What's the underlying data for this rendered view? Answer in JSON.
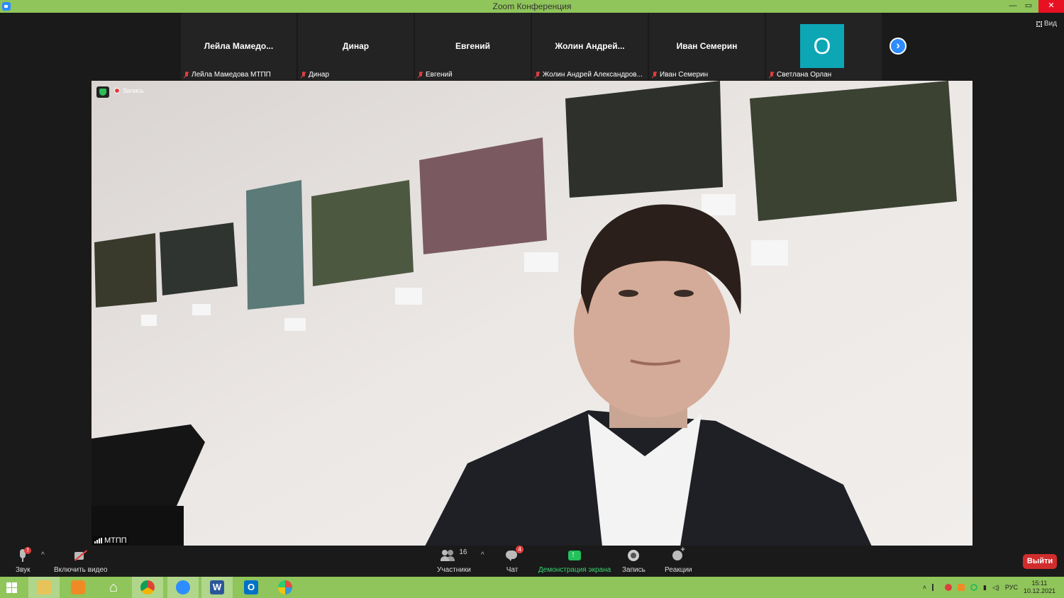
{
  "window": {
    "title": "Zoom Конференция",
    "min": "—",
    "max": "▭",
    "close": "✕"
  },
  "view_button": {
    "label": "Вид"
  },
  "thumbnails": [
    {
      "name": "Лейла  Мамедо...",
      "label": "Лейла Мамедова МТПП",
      "muted": true
    },
    {
      "name": "Динар",
      "label": "Динар",
      "muted": true
    },
    {
      "name": "Евгений",
      "label": "Евгений",
      "muted": true
    },
    {
      "name": "Жолин  Андрей...",
      "label": "Жолин Андрей Александров...",
      "muted": true
    },
    {
      "name": "Иван Семерин",
      "label": "Иван Семерин",
      "muted": true
    },
    {
      "name": "",
      "avatar_letter": "О",
      "avatar_color": "#0da6b5",
      "label": "Светлана Орлан",
      "muted": true
    }
  ],
  "video": {
    "recording_label": "Запись",
    "speaker_label": "МТПП"
  },
  "toolbar": {
    "audio": {
      "label": "Звук",
      "badge": "!"
    },
    "video": {
      "label": "Включить видео"
    },
    "participants": {
      "label": "Участники",
      "count": "16"
    },
    "chat": {
      "label": "Чат",
      "badge": "4"
    },
    "share": {
      "label": "Демонстрация экрана"
    },
    "record": {
      "label": "Запись"
    },
    "reactions": {
      "label": "Реакции"
    },
    "leave": {
      "label": "Выйти"
    }
  },
  "taskbar": {
    "language": "РУС",
    "time": "15:11",
    "date": "10.12.2021",
    "apps": [
      "windows-start",
      "file-explorer",
      "media-player",
      "home",
      "chrome",
      "zoom",
      "word",
      "outlook",
      "paint"
    ]
  },
  "colors": {
    "accent_green": "#8fc55a",
    "zoom_blue": "#2d8cff",
    "leave_red": "#d12d2d",
    "share_green": "#23c05b"
  }
}
